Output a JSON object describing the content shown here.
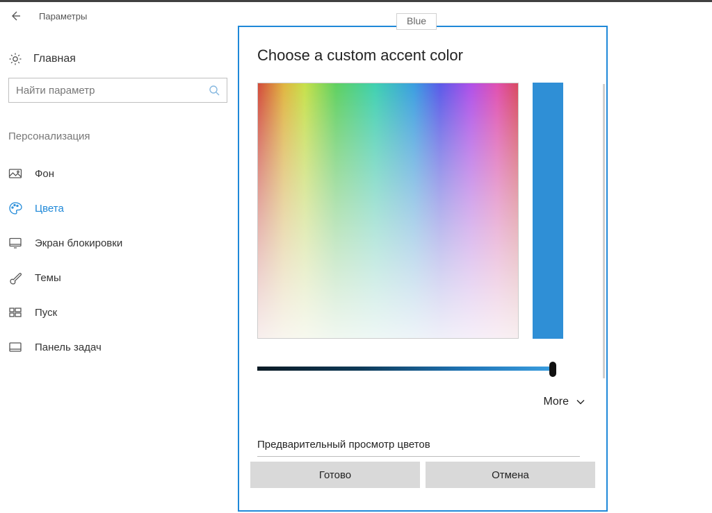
{
  "window": {
    "title": "Параметры"
  },
  "home": {
    "label": "Главная"
  },
  "search": {
    "placeholder": "Найти параметр"
  },
  "section": {
    "heading": "Персонализация"
  },
  "nav": {
    "items": [
      {
        "label": "Фон"
      },
      {
        "label": "Цвета"
      },
      {
        "label": "Экран блокировки"
      },
      {
        "label": "Темы"
      },
      {
        "label": "Пуск"
      },
      {
        "label": "Панель задач"
      }
    ],
    "selected_index": 1
  },
  "tooltip": {
    "text": "Blue"
  },
  "dialog": {
    "title": "Choose a custom accent color",
    "preview_hex": "#2f8fd6",
    "more_label": "More",
    "preview_label": "Предварительный просмотр цветов",
    "done_label": "Готово",
    "cancel_label": "Отмена"
  },
  "colors": {
    "accent": "#1e88d8"
  }
}
